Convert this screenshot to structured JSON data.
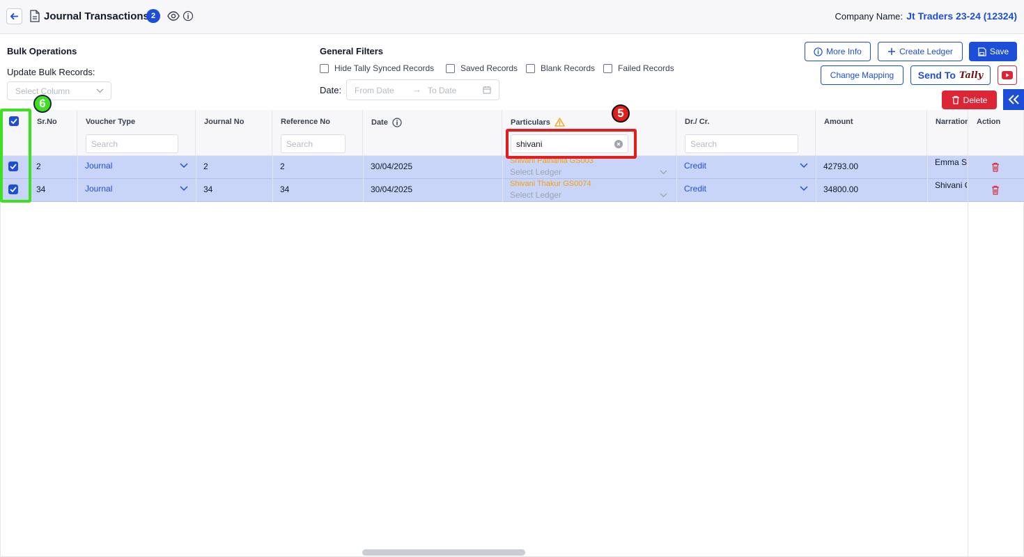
{
  "header": {
    "title": "Journal Transactions",
    "badge_count": "2",
    "company_label": "Company Name:",
    "company_value": "Jt Traders 23-24 (12324)"
  },
  "bulk": {
    "title": "Bulk Operations",
    "update_label": "Update Bulk Records:",
    "select_placeholder": "Select Column"
  },
  "filters": {
    "title": "General Filters",
    "checkboxes": [
      "Hide Tally Synced Records",
      "Saved Records",
      "Blank Records",
      "Failed Records"
    ],
    "date_label": "Date:",
    "from_placeholder": "From Date",
    "arrow": "→",
    "to_placeholder": "To Date"
  },
  "toolbar": {
    "more_info": "More Info",
    "create_ledger": "Create Ledger",
    "save": "Save",
    "change_mapping": "Change Mapping",
    "send_to": "Send To",
    "tally_logo": "Tally",
    "delete": "Delete"
  },
  "table": {
    "columns": [
      "Sr.No",
      "Voucher Type",
      "Journal No",
      "Reference No",
      "Date",
      "Particulars",
      "Dr./ Cr.",
      "Amount",
      "Narration",
      "Action"
    ],
    "search_placeholder": "Search",
    "particulars_search_value": "shivani",
    "select_ledger_placeholder": "Select Ledger",
    "rows": [
      {
        "sr": "2",
        "voucher": "Journal",
        "journal_no": "2",
        "reference_no": "2",
        "date": "30/04/2025",
        "particular": "Shivani Pathania GS003",
        "drcr": "Credit",
        "amount": "42793.00",
        "narration": "Emma S"
      },
      {
        "sr": "34",
        "voucher": "Journal",
        "journal_no": "34",
        "reference_no": "34",
        "date": "30/04/2025",
        "particular": "Shivani Thakur GS0074",
        "drcr": "Credit",
        "amount": "34800.00",
        "narration": "Shivani C"
      }
    ]
  },
  "annotations": {
    "step_red": "5",
    "step_green": "6"
  },
  "colors": {
    "accent": "#1d4ed8",
    "danger": "#dc2636",
    "selected_row": "#c8d5f8",
    "warning": "#f59e0b"
  }
}
